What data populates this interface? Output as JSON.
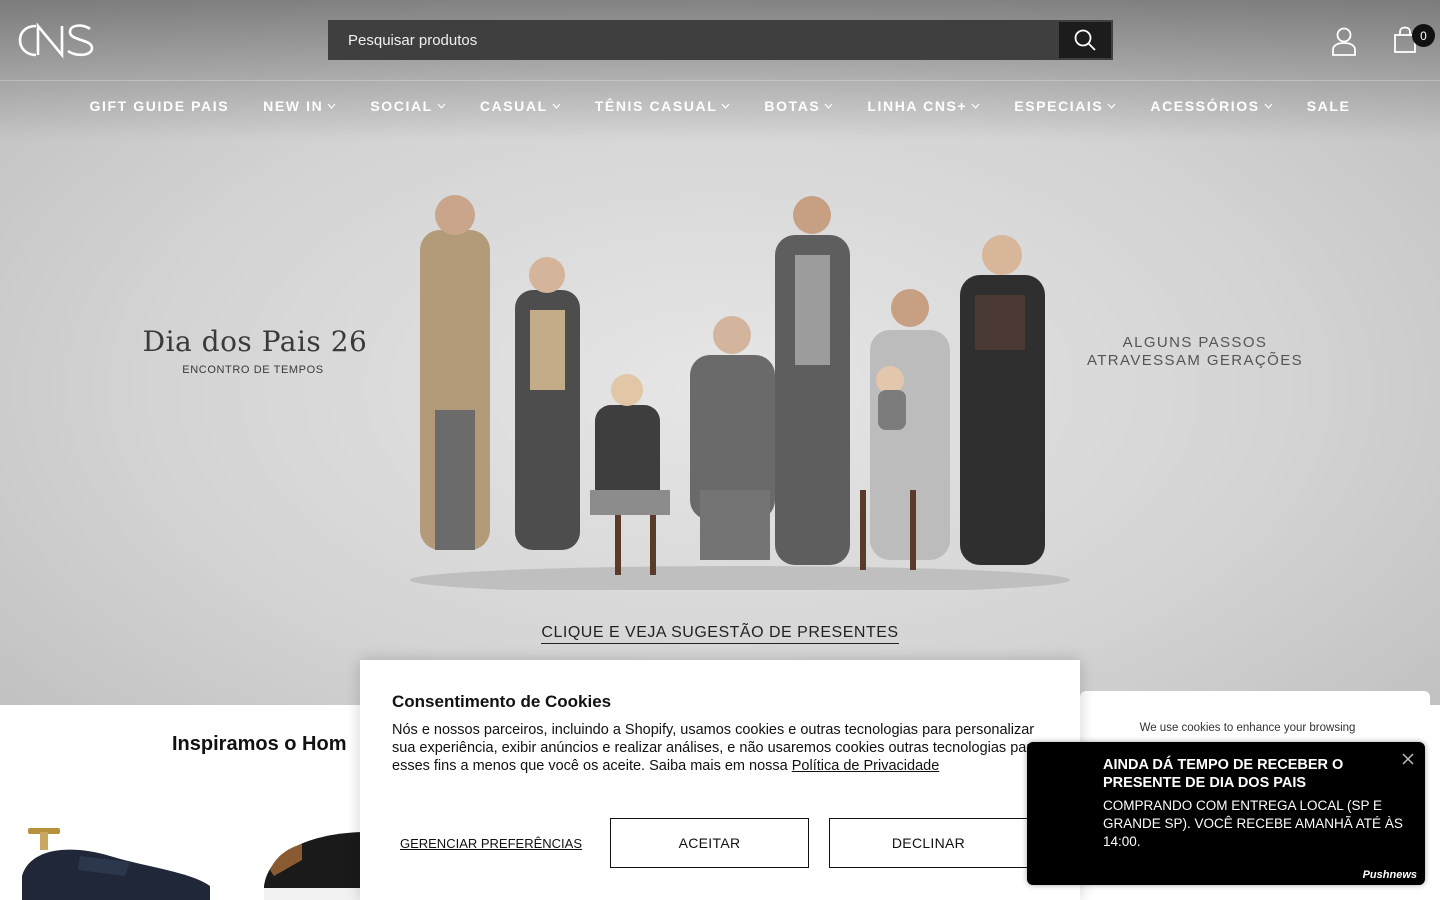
{
  "header": {
    "logo_text": "CNS",
    "search_placeholder": "Pesquisar produtos",
    "cart_count": "0"
  },
  "nav": {
    "items": [
      {
        "label": "GIFT GUIDE PAIS",
        "has_dropdown": false
      },
      {
        "label": "NEW IN",
        "has_dropdown": true
      },
      {
        "label": "SOCIAL",
        "has_dropdown": true
      },
      {
        "label": "CASUAL",
        "has_dropdown": true
      },
      {
        "label": "TÊNIS CASUAL",
        "has_dropdown": true
      },
      {
        "label": "BOTAS",
        "has_dropdown": true
      },
      {
        "label": "LINHA CNS+",
        "has_dropdown": true
      },
      {
        "label": "ESPECIAIS",
        "has_dropdown": true
      },
      {
        "label": "ACESSÓRIOS",
        "has_dropdown": true
      },
      {
        "label": "SALE",
        "has_dropdown": false
      }
    ]
  },
  "hero": {
    "title": "Dia dos Pais 26",
    "subtitle": "ENCONTRO DE TEMPOS",
    "right_line1": "ALGUNS PASSOS",
    "right_line2": "ATRAVESSAM GERAÇÕES",
    "cta": "CLIQUE E VEJA SUGESTÃO DE PRESENTES"
  },
  "section": {
    "title": "Inspiramos o Hom"
  },
  "cookie_modal": {
    "title": "Consentimento de Cookies",
    "body": "Nós e nossos parceiros, incluindo a Shopify, usamos cookies e outras tecnologias para personalizar sua experiência, exibir anúncios e realizar análises, e não usaremos cookies outras tecnologias para esses fins a menos que você os aceite. Saiba mais em nossa Política de Privacidade.",
    "privacy_link": "Política de Privacidade",
    "manage_label": "GERENCIAR PREFERÊNCIAS",
    "accept_label": "ACEITAR",
    "decline_label": "DECLINAR"
  },
  "cookie_card": {
    "text": "We use cookies to enhance your browsing"
  },
  "push_popup": {
    "title": "AINDA DÁ TEMPO DE RECEBER O PRESENTE DE DIA DOS PAIS",
    "body": "COMPRANDO COM ENTREGA LOCAL (SP E GRANDE SP). VOCÊ RECEBE AMANHÃ ATÉ ÀS 14:00.",
    "brand": "Pushnews"
  }
}
